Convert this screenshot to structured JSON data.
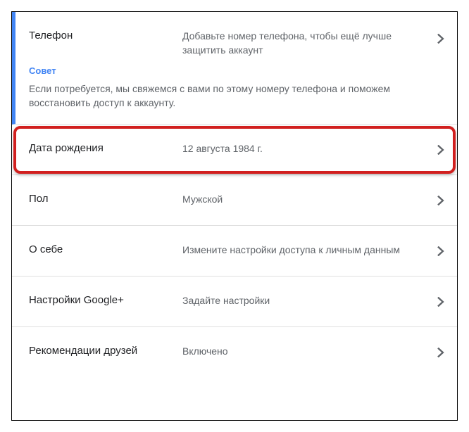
{
  "phone": {
    "label": "Телефон",
    "value": "Добавьте номер телефона, чтобы ещё лучше защитить аккаунт",
    "tip_label": "Совет",
    "tip_text": "Если потребуется, мы свяжемся с вами по этому номеру телефона и поможем восстановить доступ к аккаунту."
  },
  "birthday": {
    "label": "Дата рождения",
    "value": "12 августа 1984 г."
  },
  "gender": {
    "label": "Пол",
    "value": "Мужской"
  },
  "about": {
    "label": "О себе",
    "value": "Измените настройки доступа к личным данным"
  },
  "gplus": {
    "label": "Настройки Google+",
    "value": "Задайте настройки"
  },
  "friends": {
    "label": "Рекомендации друзей",
    "value": "Включено"
  }
}
